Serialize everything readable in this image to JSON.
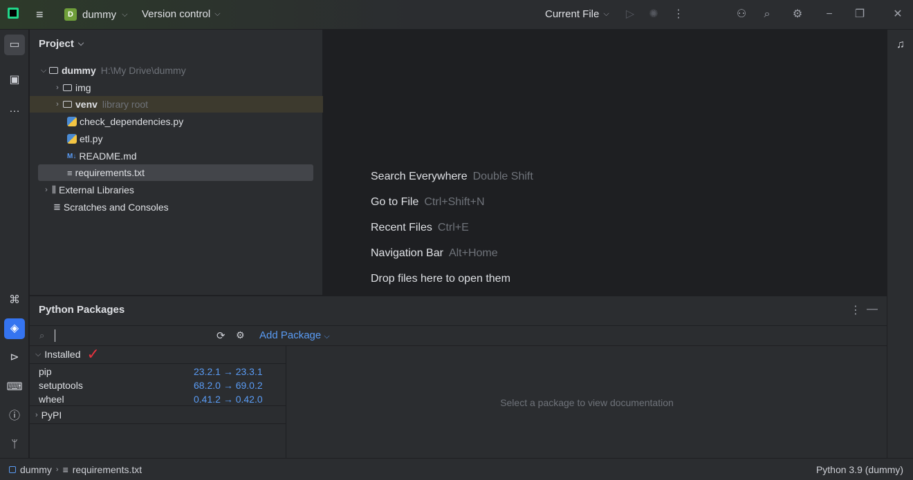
{
  "titlebar": {
    "project_badge": "D",
    "project_name": "dummy",
    "version_control": "Version control",
    "run_config": "Current File"
  },
  "project_panel": {
    "title": "Project",
    "tree": [
      {
        "label": "dummy",
        "hint": "H:\\My Drive\\dummy"
      },
      {
        "label": "img"
      },
      {
        "label": "venv",
        "hint": "library root"
      },
      {
        "label": "check_dependencies.py"
      },
      {
        "label": "etl.py"
      },
      {
        "label": "README.md",
        "icon_text": "M↓"
      },
      {
        "label": "requirements.txt"
      },
      {
        "label": "External Libraries"
      },
      {
        "label": "Scratches and Consoles"
      }
    ]
  },
  "editor": {
    "welcome": [
      {
        "action": "Search Everywhere",
        "shortcut": "Double Shift"
      },
      {
        "action": "Go to File",
        "shortcut": "Ctrl+Shift+N"
      },
      {
        "action": "Recent Files",
        "shortcut": "Ctrl+E"
      },
      {
        "action": "Navigation Bar",
        "shortcut": "Alt+Home"
      },
      {
        "action": "Drop files here to open them",
        "shortcut": ""
      }
    ]
  },
  "packages": {
    "title": "Python Packages",
    "add_package": "Add Package",
    "installed_label": "Installed",
    "installed": [
      {
        "name": "pip",
        "version": "23.2.1 → 23.3.1"
      },
      {
        "name": "setuptools",
        "version": "68.2.0 → 69.0.2"
      },
      {
        "name": "wheel",
        "version": "0.41.2 → 0.42.0"
      }
    ],
    "pypi_label": "PyPI",
    "doc_placeholder": "Select a package to view documentation"
  },
  "statusbar": {
    "module": "dummy",
    "file": "requirements.txt",
    "interpreter": "Python 3.9 (dummy)"
  },
  "colors": {
    "accent": "#3574f0",
    "link": "#5a9cf5",
    "checkmark": "#e8333f"
  }
}
